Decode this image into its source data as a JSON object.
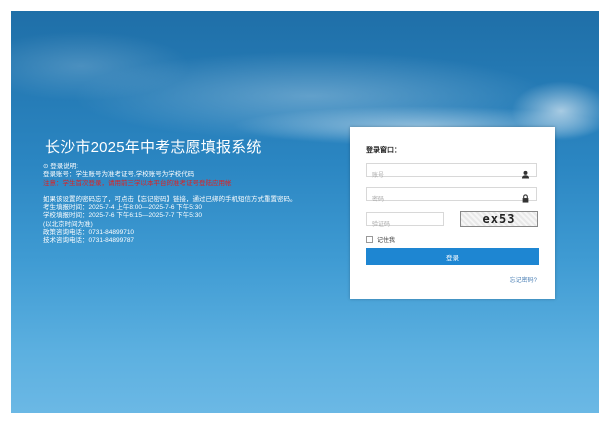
{
  "system": {
    "title": "长沙市2025年中考志愿填报系统"
  },
  "info": {
    "lines": [
      {
        "text": "⊙ 登录说明:",
        "red": false
      },
      {
        "text": "登录账号：学生账号为准考证号,学校账号为学校代码",
        "red": false
      },
      {
        "text": "注意：学生首次登录，请用前三学以本平台的准考证号登陆应用帐",
        "red": true
      },
      {
        "text": "",
        "red": false
      },
      {
        "text": "如果该设置的密码忘了，可点击【忘记密码】链接，通过已绑的手机短信方式重置密码。",
        "red": false
      },
      {
        "text": "考生填报时间：2025-7-4 上午8:00—2025-7-6 下午5:30",
        "red": false
      },
      {
        "text": "学校填报时间：2025-7-6 下午6:15—2025-7-7 下午5:30",
        "red": false
      },
      {
        "text": "(以北京时间为准)",
        "red": false
      },
      {
        "text": "政策咨询电话：0731-84899710",
        "red": false
      },
      {
        "text": "技术咨询电话：0731-84899787",
        "red": false
      }
    ]
  },
  "login": {
    "title": "登录窗口：",
    "account_placeholder": "账号",
    "password_placeholder": "密码",
    "captcha_placeholder": "验证码",
    "captcha_text": "ex53",
    "remember_label": "记住我",
    "submit_label": "登录",
    "forgot_label": "忘记密码?",
    "icons": {
      "account": "user-icon",
      "password": "lock-icon"
    }
  },
  "colors": {
    "background_top": "#1f6fa8",
    "background_bottom": "#6bb8e5",
    "button": "#1e86d2",
    "warning": "#e02020",
    "link": "#4a7fb5"
  }
}
